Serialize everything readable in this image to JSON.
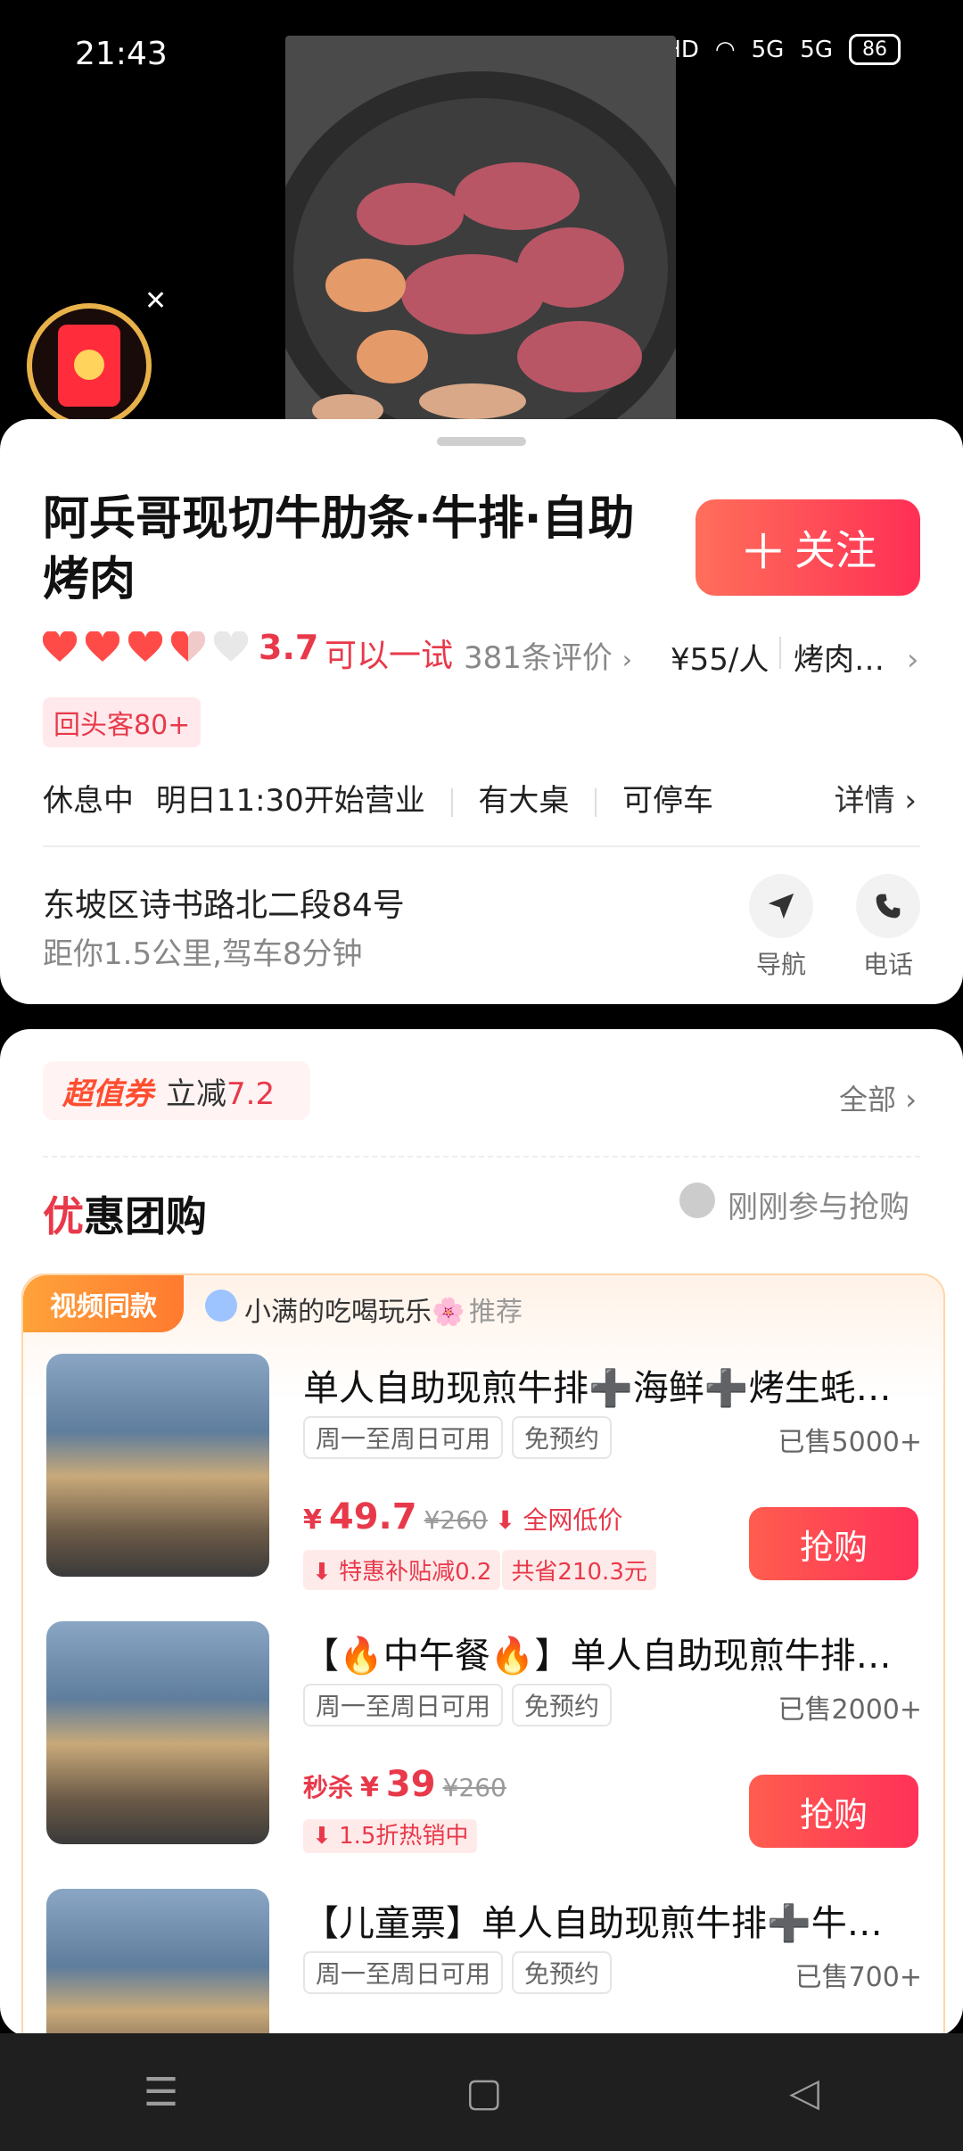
{
  "status_bar": {
    "time": "21:43",
    "indicators": [
      "bluetooth-icon",
      "location-icon",
      "HD",
      "wifi-icon",
      "5G",
      "5G"
    ],
    "battery": "86"
  },
  "shop": {
    "name": "阿兵哥现切牛肋条·牛排·自助烤肉",
    "follow_label": "关注",
    "rating": "3.7",
    "rating_word": "可以一试",
    "reviews": "381条评价",
    "price_per_person": "¥55/人",
    "category": "烤肉…",
    "badge": "回头客80+",
    "status": "休息中",
    "hours": "明日11:30开始营业",
    "features": [
      "有大桌",
      "可停车"
    ],
    "detail_label": "详情",
    "address": "东坡区诗书路北二段84号",
    "distance": "距你1.5公里,驾车8分钟",
    "nav_label": "导航",
    "phone_label": "电话"
  },
  "coupon": {
    "tag": "超值券",
    "text_prefix": "立减",
    "amount": "7.2",
    "all_label": "全部"
  },
  "groupbuy": {
    "title_first": "优",
    "title_rest": "惠团购",
    "join_text": "刚刚参与抢购",
    "video_tag": "视频同款",
    "recommender": "小满的吃喝玩乐🌸",
    "recommend_word": "推荐",
    "deals": [
      {
        "title": "单人自助现煎牛排➕海鲜➕烤生蚝…",
        "chips": [
          "周一至周日可用",
          "免预约"
        ],
        "sold": "已售5000+",
        "price": "49.7",
        "old_price": "¥260",
        "low_badge": "全网低价",
        "subsidy": "特惠补贴减0.2",
        "saved": "共省210.3元",
        "buy_label": "抢购"
      },
      {
        "title": "【🔥中午餐🔥】单人自助现煎牛排…",
        "chips": [
          "周一至周日可用",
          "免预约"
        ],
        "sold": "已售2000+",
        "flash_label": "秒杀",
        "price": "39",
        "old_price": "¥260",
        "subsidy": "1.5折热销中",
        "buy_label": "抢购"
      },
      {
        "title": "【儿童票】单人自助现煎牛排➕牛…",
        "chips": [
          "周一至周日可用",
          "免预约"
        ],
        "sold": "已售700+"
      }
    ]
  },
  "colors": {
    "accent": "#e8394a",
    "follow_gradient": [
      "#ff6f5a",
      "#ff2f55"
    ],
    "video_tag": "#ff8a33"
  }
}
